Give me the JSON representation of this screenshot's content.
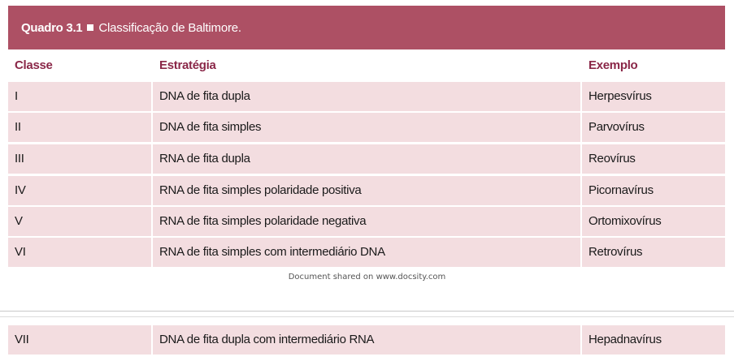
{
  "table": {
    "title_number": "Quadro 3.1",
    "title_text": "Classificação de Baltimore.",
    "headers": {
      "classe": "Classe",
      "estrategia": "Estratégia",
      "exemplo": "Exemplo"
    },
    "rows": [
      {
        "classe": "I",
        "estrategia": "DNA de fita dupla",
        "exemplo": "Herpesvírus"
      },
      {
        "classe": "II",
        "estrategia": "DNA de fita simples",
        "exemplo": "Parvovírus"
      },
      {
        "classe": "III",
        "estrategia": "RNA de fita dupla",
        "exemplo": "Reovírus"
      },
      {
        "classe": "IV",
        "estrategia": "RNA de fita simples polaridade positiva",
        "exemplo": "Picornavírus"
      },
      {
        "classe": "V",
        "estrategia": "RNA de fita simples polaridade negativa",
        "exemplo": "Ortomixovírus"
      },
      {
        "classe": "VI",
        "estrategia": "RNA de fita simples com intermediário DNA",
        "exemplo": "Retrovírus"
      },
      {
        "classe": "VII",
        "estrategia": "DNA de fita dupla com intermediário RNA",
        "exemplo": "Hepadnavírus"
      }
    ]
  },
  "footer": {
    "note": "Document shared on www.docsity.com"
  },
  "colors": {
    "title_bg": "#ad5064",
    "header_text": "#8a2748",
    "row_bg": "#f3dde0"
  }
}
